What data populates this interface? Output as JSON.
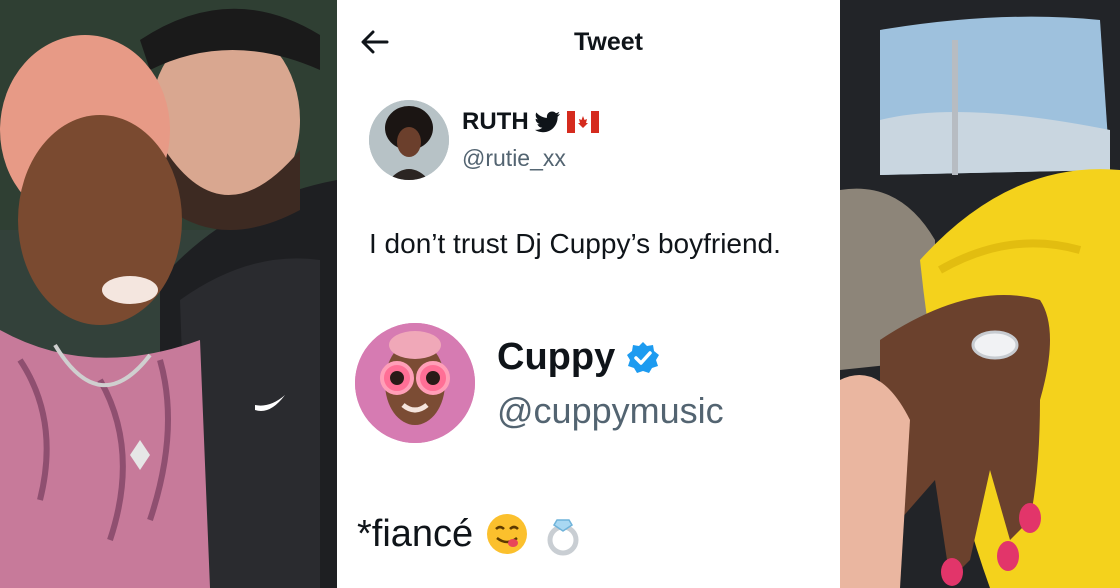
{
  "header": {
    "title": "Tweet",
    "back_icon": "arrow-left-icon"
  },
  "original_tweet": {
    "name": "RUTH",
    "name_badges": [
      "twitter-bird-icon",
      "canada-flag-icon"
    ],
    "handle": "@rutie_xx",
    "text": "I don’t trust Dj Cuppy’s boyfriend."
  },
  "reply_tweet": {
    "name": "Cuppy",
    "verified_icon": "verified-badge-icon",
    "handle": "@cuppymusic",
    "text": "*fiancé",
    "emojis": [
      "savoring-face-icon",
      "ring-icon"
    ]
  },
  "photos": {
    "left": {
      "description_icon": "couple-selfie-photo"
    },
    "right": {
      "description_icon": "engagement-ring-hand-photo"
    }
  },
  "colors": {
    "text_primary": "#0f1419",
    "text_secondary": "#536471",
    "verified_blue": "#1d9bf0",
    "twitter_blue": "#1d9bf0",
    "canada_red": "#d52b1e"
  }
}
